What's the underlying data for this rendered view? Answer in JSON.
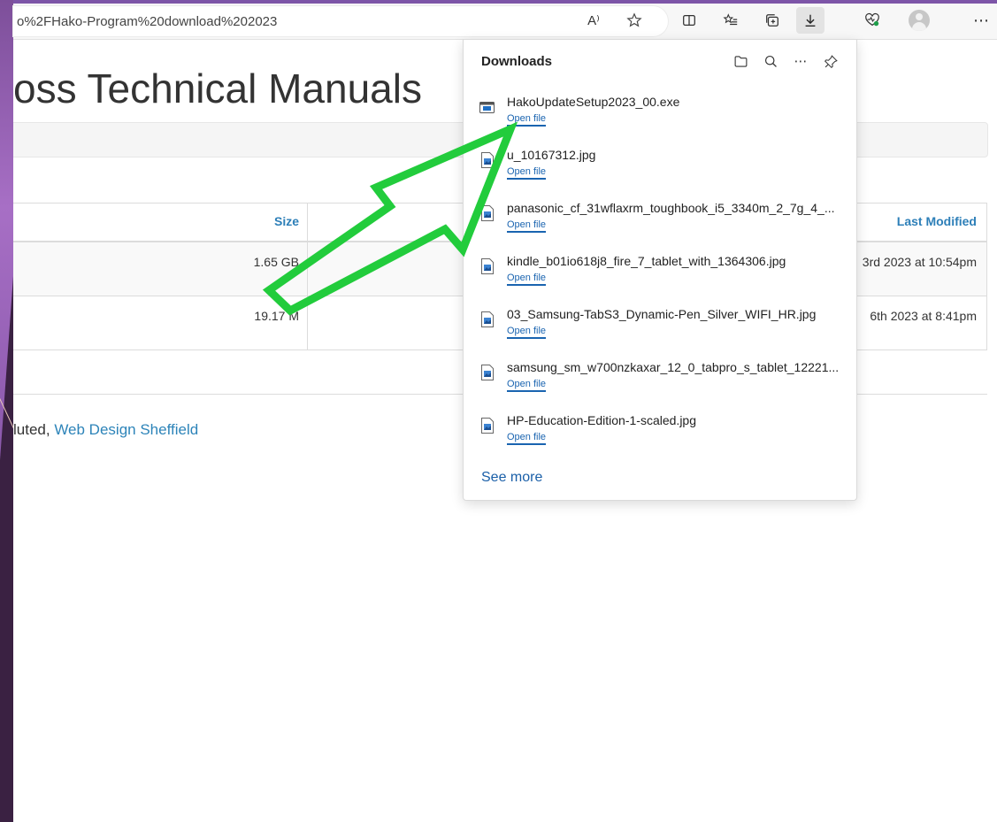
{
  "browser": {
    "url": "o%2FHako-Program%20download%202023",
    "toolbar_icons": [
      "read-aloud-icon",
      "favorite-star-icon",
      "split-screen-icon",
      "favorites-list-icon",
      "collections-icon",
      "download-icon",
      "browser-essentials-icon",
      "profile-avatar-icon",
      "more-options-icon"
    ],
    "read_aloud_glyph": "A⁾",
    "more_glyph": "⋯"
  },
  "page": {
    "title": "oss Technical Manuals",
    "table": {
      "headers": {
        "size": "Size",
        "last_modified": "Last Modified"
      },
      "rows": [
        {
          "size": "1.65 GB",
          "last_modified": "3rd 2023 at 10:54pm"
        },
        {
          "size": "19.17 M",
          "last_modified": "6th 2023 at 8:41pm"
        }
      ]
    },
    "footer": {
      "prefix": "luted, ",
      "link": "Web Design Sheffield"
    }
  },
  "downloads": {
    "title": "Downloads",
    "open_file_label": "Open file",
    "items": [
      {
        "name": "HakoUpdateSetup2023_00.exe",
        "icon": "exe-icon",
        "action": "Open file"
      },
      {
        "name": "u_10167312.jpg",
        "icon": "image-file-icon",
        "action": "Open file"
      },
      {
        "name": "panasonic_cf_31wflaxrm_toughbook_i5_3340m_2_7g_4_...",
        "icon": "image-file-icon",
        "action": "Open file"
      },
      {
        "name": "kindle_b01io618j8_fire_7_tablet_with_1364306.jpg",
        "icon": "image-file-icon",
        "action": "Open file"
      },
      {
        "name": "03_Samsung-TabS3_Dynamic-Pen_Silver_WIFI_HR.jpg",
        "icon": "image-file-icon",
        "action": "Open file"
      },
      {
        "name": "samsung_sm_w700nzkaxar_12_0_tabpro_s_tablet_12221...",
        "icon": "image-file-icon",
        "action": "Open file"
      },
      {
        "name": "HP-Education-Edition-1-scaled.jpg",
        "icon": "image-file-icon",
        "action": "Open file"
      }
    ],
    "see_more": "See more"
  },
  "colors": {
    "annotation_arrow": "#22cc3c",
    "link_blue": "#1a64b0",
    "header_blue": "#2d7fb8",
    "slide_purple": "#7d4f9a"
  }
}
